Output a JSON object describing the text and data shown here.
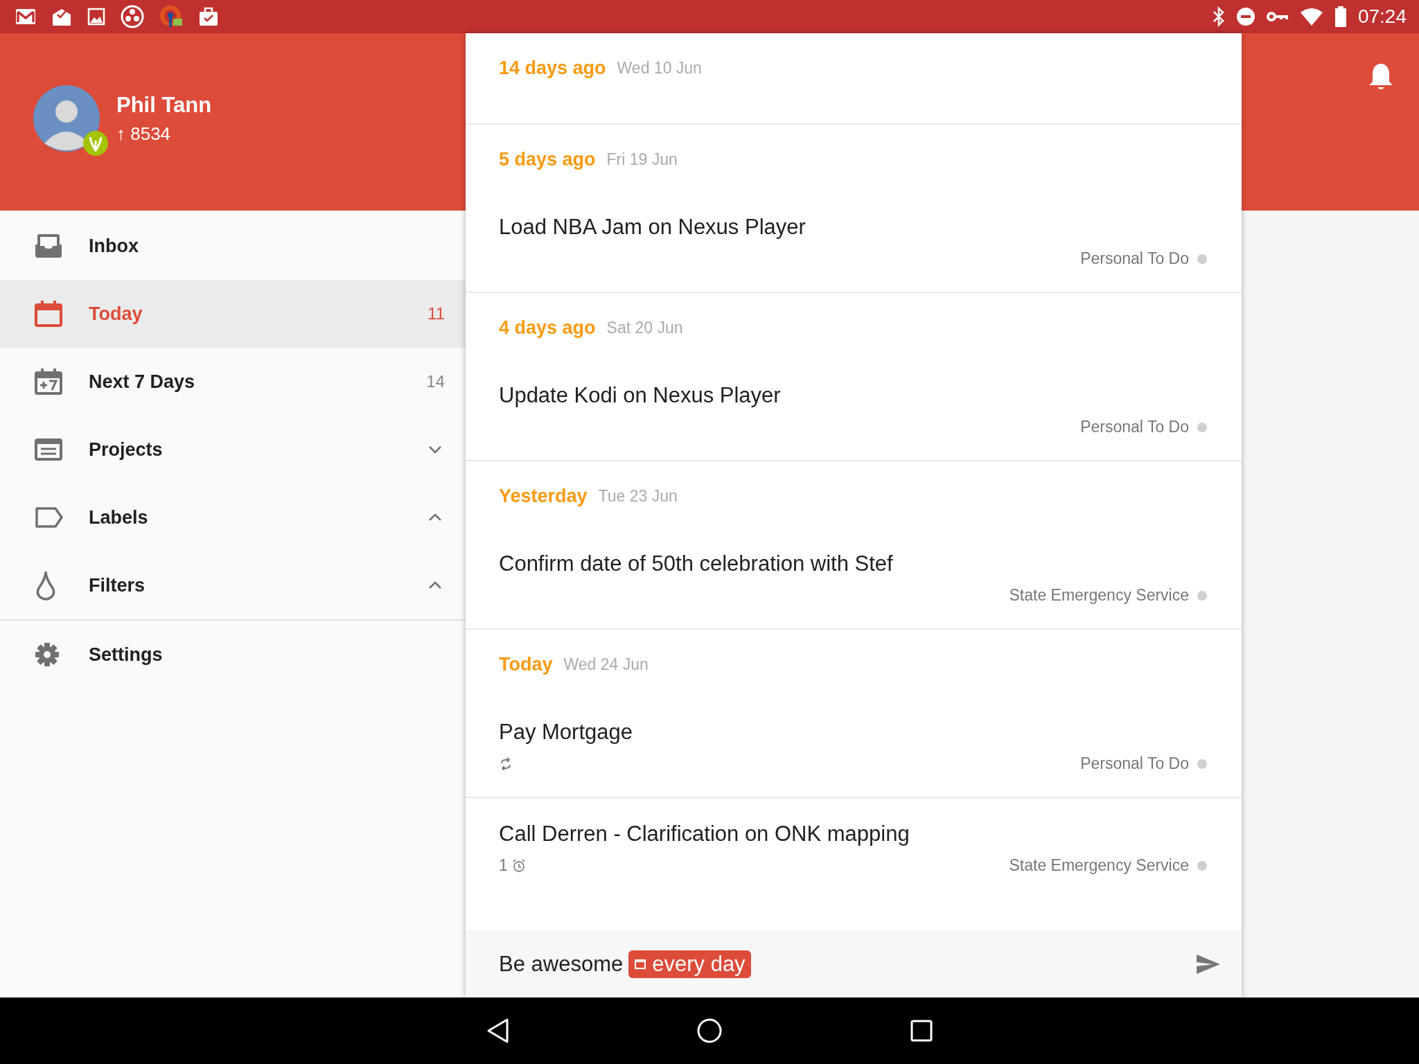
{
  "status_bar": {
    "time": "07:24"
  },
  "profile": {
    "name": "Phil Tann",
    "karma": "↑ 8534"
  },
  "sidebar": {
    "items": [
      {
        "label": "Inbox",
        "selected": false,
        "kind": "nav"
      },
      {
        "label": "Today",
        "count": "11",
        "selected": true,
        "kind": "nav"
      },
      {
        "label": "Next 7 Days",
        "count": "14",
        "selected": false,
        "kind": "nav"
      },
      {
        "label": "Projects",
        "selected": false,
        "kind": "group",
        "expanded": false
      },
      {
        "label": "Labels",
        "selected": false,
        "kind": "group",
        "expanded": true
      },
      {
        "label": "Filters",
        "selected": false,
        "kind": "group",
        "expanded": true
      }
    ],
    "footer_items": [
      {
        "label": "Settings"
      }
    ]
  },
  "sections": [
    {
      "relative": "14 days ago",
      "date": "Wed 10 Jun"
    },
    {
      "relative": "5 days ago",
      "date": "Fri 19 Jun",
      "tasks": [
        {
          "title": "Load NBA Jam on Nexus Player",
          "project": "Personal To Do",
          "recurring": false
        }
      ]
    },
    {
      "relative": "4 days ago",
      "date": "Sat 20 Jun",
      "tasks": [
        {
          "title": "Update Kodi on Nexus Player",
          "project": "Personal To Do",
          "recurring": false
        }
      ]
    },
    {
      "relative": "Yesterday",
      "date": "Tue 23 Jun",
      "tasks": [
        {
          "title": "Confirm date of 50th celebration with Stef",
          "project": "State Emergency Service",
          "recurring": false
        }
      ]
    },
    {
      "relative": "Today",
      "date": "Wed 24 Jun",
      "tasks": [
        {
          "title": "Pay Mortgage",
          "project": "Personal To Do",
          "recurring": true
        },
        {
          "title": "Call Derren - Clarification on ONK mapping",
          "project": "State Emergency Service",
          "recurring": false,
          "reminders": "1"
        }
      ]
    }
  ],
  "quick_add": {
    "text": "Be awesome",
    "date_chip": "every day"
  }
}
